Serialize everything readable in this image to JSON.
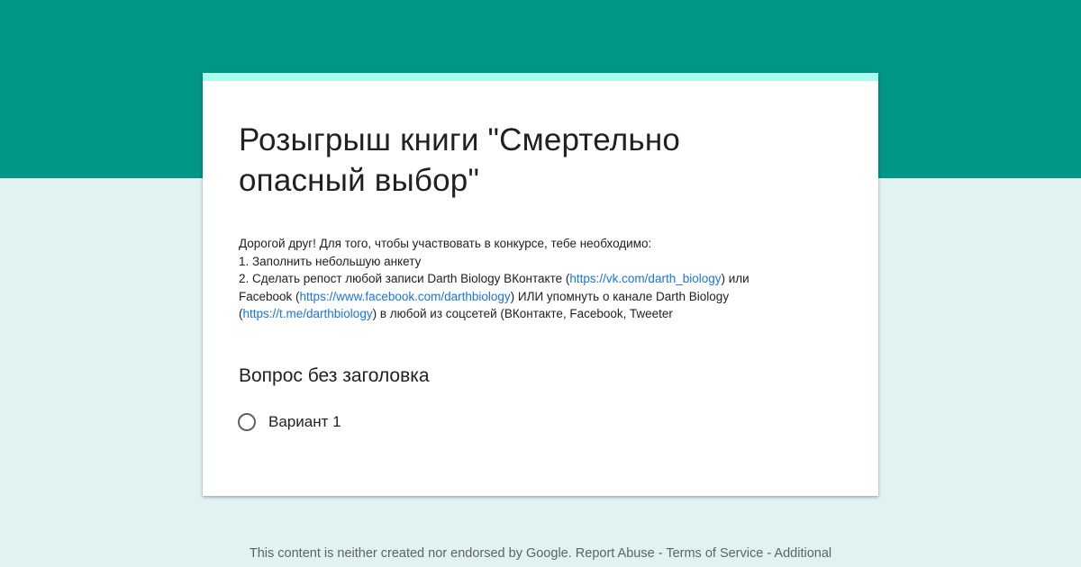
{
  "form": {
    "title_line1": "Розыгрыш книги \"Смертельно",
    "title_line2": "опасный выбор\"",
    "description": {
      "line1": "Дорогой друг! Для того, чтобы участвовать в конкурсе, тебе необходимо:",
      "line2": "1. Заполнить небольшую анкету",
      "line3_before": "2. Сделать репост любой записи Darth Biology ВКонтакте (",
      "line3_link": "https://vk.com/darth_biology",
      "line3_after": ") или",
      "line4_before": "Facebook (",
      "line4_link": "https://www.facebook.com/darthbiology",
      "line4_after": ") ИЛИ упомнуть о канале Darth Biology",
      "line5_before": "(",
      "line5_link": "https://t.me/darthbiology",
      "line5_after": ") в любой из соцсетей (ВКонтакте, Facebook, Tweeter"
    }
  },
  "question": {
    "title": "Вопрос без заголовка",
    "options": [
      {
        "label": "Вариант 1",
        "selected": false
      }
    ]
  },
  "footer": {
    "notice": "This content is neither created nor endorsed by Google.",
    "report_abuse": "Report Abuse",
    "separator": "-",
    "terms": "Terms of Service",
    "additional": "Additional"
  },
  "colors": {
    "header": "#009688",
    "background": "#e0f2f1",
    "accent": "#a7ffeb",
    "link": "#1a73e8"
  }
}
